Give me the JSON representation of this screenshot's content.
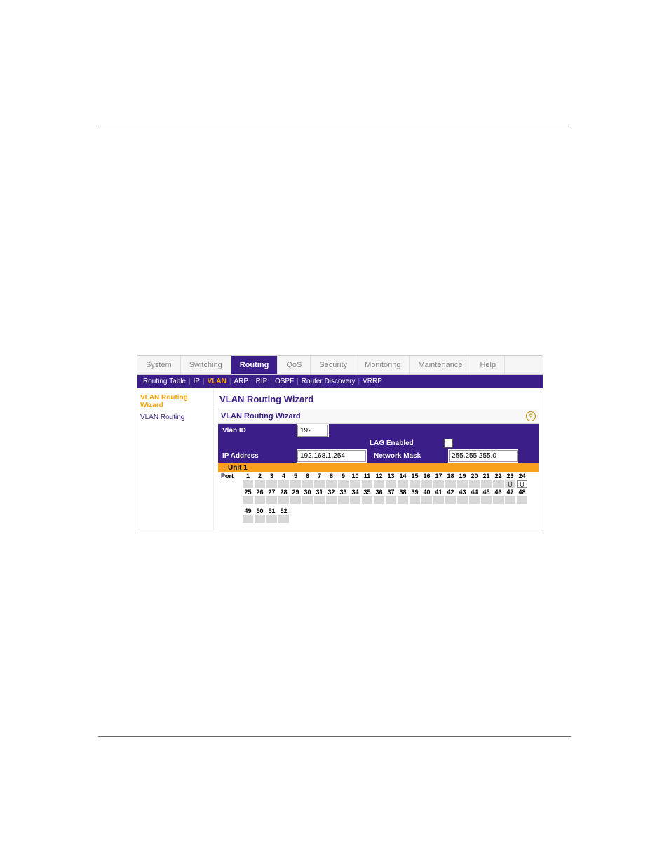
{
  "tabs": {
    "system": "System",
    "switching": "Switching",
    "routing": "Routing",
    "qos": "QoS",
    "security": "Security",
    "monitoring": "Monitoring",
    "maintenance": "Maintenance",
    "help": "Help"
  },
  "subnav": {
    "routing_table": "Routing Table",
    "ip": "IP",
    "vlan": "VLAN",
    "arp": "ARP",
    "rip": "RIP",
    "ospf": "OSPF",
    "router_discovery": "Router Discovery",
    "vrrp": "VRRP"
  },
  "sidebar": {
    "wizard": "VLAN Routing Wizard",
    "vlan_routing": "VLAN Routing"
  },
  "main": {
    "title": "VLAN Routing Wizard",
    "panel_title": "VLAN Routing Wizard",
    "vlan_id_label": "Vlan ID",
    "vlan_id_value": "192",
    "lag_enabled_label": "LAG Enabled",
    "ip_address_label": "IP Address",
    "ip_address_value": "192.168.1.254",
    "network_mask_label": "Network Mask",
    "network_mask_value": "255.255.255.0",
    "unit_label": "Unit 1",
    "port_label": "Port",
    "port_special_23": "U",
    "port_special_24": "U",
    "port_row1": [
      "1",
      "2",
      "3",
      "4",
      "5",
      "6",
      "7",
      "8",
      "9",
      "10",
      "11",
      "12",
      "13",
      "14",
      "15",
      "16",
      "17",
      "18",
      "19",
      "20",
      "21",
      "22",
      "23",
      "24"
    ],
    "port_row2": [
      "25",
      "26",
      "27",
      "28",
      "29",
      "30",
      "31",
      "32",
      "33",
      "34",
      "35",
      "36",
      "37",
      "38",
      "39",
      "40",
      "41",
      "42",
      "43",
      "44",
      "45",
      "46",
      "47",
      "48"
    ],
    "port_row3": [
      "49",
      "50",
      "51",
      "52"
    ]
  }
}
